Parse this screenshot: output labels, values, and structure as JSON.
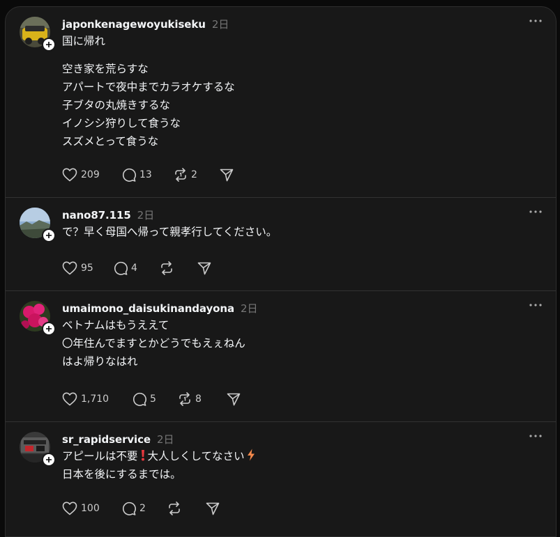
{
  "posts": [
    {
      "username": "japonkenagewoyukiseku",
      "time": "2日",
      "lines": [
        "国に帰れ",
        "空き家を荒らすな",
        "アパートで夜中までカラオケするな",
        "子ブタの丸焼きするな",
        "イノシシ狩りして食うな",
        "スズメとって食うな"
      ],
      "likes": "209",
      "comments": "13",
      "reposts": "2",
      "avatar": "yellow-car-photo"
    },
    {
      "username": "nano87.115",
      "time": "2日",
      "lines": [
        "で？早く母国へ帰って親孝行してください。"
      ],
      "likes": "95",
      "comments": "4",
      "reposts": "",
      "avatar": "landscape-photo"
    },
    {
      "username": "umaimono_daisukinandayona",
      "time": "2日",
      "lines": [
        "ベトナムはもうええて",
        "〇年住んでますとかどうでもえぇねん",
        "はよ帰りなはれ"
      ],
      "likes": "1,710",
      "comments": "5",
      "reposts": "8",
      "avatar": "pink-flowers-photo"
    },
    {
      "username": "sr_rapidservice",
      "time": "2日",
      "lines": [
        "アピールは不要",
        "大人しくしてなさい",
        "日本を後にするまでは。"
      ],
      "likes": "100",
      "comments": "2",
      "reposts": "",
      "avatar": "train-photo",
      "emoji": [
        "exclamation-mark-icon",
        "lightning-icon"
      ]
    }
  ],
  "colors": {
    "background": "#181818",
    "text": "#f3f5f7",
    "secondary": "#777777",
    "divider": "#323232",
    "exclamation": "#e8383d",
    "lightning": "#f4894b"
  }
}
